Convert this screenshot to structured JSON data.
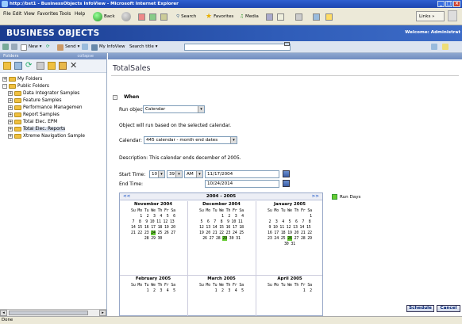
{
  "window": {
    "title": "http://bst1 - BusinessObjects InfoView - Microsoft Internet Explorer"
  },
  "menu": [
    "File",
    "Edit",
    "View",
    "Favorites",
    "Tools",
    "Help"
  ],
  "ietoolbar": {
    "back": "Back",
    "search": "Search",
    "favorites": "Favorites",
    "media": "Media",
    "links": "Links"
  },
  "app": {
    "logo": "BUSINESS OBJECTS",
    "welcome": "Welcome: Administrat"
  },
  "toolbar2": {
    "new": "New",
    "send": "Send",
    "myinfoview": "My InfoView",
    "search_label": "Search title"
  },
  "folders": {
    "title": "Folders",
    "collapse": "collapse",
    "items": [
      {
        "label": "My Folders",
        "level": 0,
        "expander": "+"
      },
      {
        "label": "Public Folders",
        "level": 0,
        "expander": "-"
      },
      {
        "label": "Data Integrator Samples",
        "level": 1,
        "expander": "+"
      },
      {
        "label": "Feature Samples",
        "level": 1,
        "expander": "+"
      },
      {
        "label": "Performance Managemen",
        "level": 1,
        "expander": "+"
      },
      {
        "label": "Report Samples",
        "level": 1,
        "expander": "+"
      },
      {
        "label": "Total Elec. EPM",
        "level": 1,
        "expander": "+"
      },
      {
        "label": "Total Elec. Reports",
        "level": 1,
        "expander": "+",
        "selected": true
      },
      {
        "label": "Xtreme Navigation Sample",
        "level": 1,
        "expander": "+"
      }
    ]
  },
  "main": {
    "title": "TotalSales",
    "when": {
      "label": "When",
      "expander": "-",
      "run_object_label": "Run object:",
      "run_object_value": "Calendar",
      "info": "Object will run based on the selected calendar.",
      "calendar_label": "Calendar:",
      "calendar_value": "445 calendar - month end dates",
      "description": "Description: This calendar ends december of 2005.",
      "start_label": "Start Time:",
      "start_hour": "10",
      "start_min": "39",
      "start_ampm": "AM",
      "start_date": "11/17/2004",
      "end_label": "End Time:",
      "end_date": "10/24/2014"
    },
    "calendar": {
      "range": "2004 - 2005",
      "prev": "<<",
      "next": ">>",
      "months": [
        {
          "name": "November 2004",
          "rows": [
            "Su Mo Tu We Th Fr Sa",
            "    1  2  3  4  5  6",
            "7  8  9 10 11 12 13",
            "14 15 16 17 18 19 20",
            "21 22 23 24 25 26 27",
            "28 29 30"
          ],
          "highlight": "24"
        },
        {
          "name": "December 2004",
          "rows": [
            "Su Mo Tu We Th Fr Sa",
            "          1  2  3  4",
            "5  6  7  8  9 10 11",
            "12 13 14 15 16 17 18",
            "19 20 21 22 23 24 25",
            "26 27 28 29 30 31"
          ],
          "highlight": "29"
        },
        {
          "name": "January 2005",
          "rows": [
            "Su Mo Tu We Th Fr Sa",
            "                   1",
            "2  3  4  5  6  7  8",
            "9 10 11 12 13 14 15",
            "16 17 18 19 20 21 22",
            "23 24 25 26 27 28 29",
            "30 31"
          ],
          "highlight": "26"
        },
        {
          "name": "February 2005",
          "rows": [
            "Su Mo Tu We Th Fr Sa",
            "       1  2  3  4  5"
          ],
          "highlight": ""
        },
        {
          "name": "March 2005",
          "rows": [
            "Su Mo Tu We Th Fr Sa",
            "       1  2  3  4  5"
          ],
          "highlight": ""
        },
        {
          "name": "April 2005",
          "rows": [
            "Su Mo Tu We Th Fr Sa",
            "                1  2"
          ],
          "highlight": ""
        }
      ]
    },
    "legend": "Run Days",
    "schedule_button": "Schedule",
    "cancel_button": "Cancel"
  },
  "status": {
    "text": "Done"
  },
  "colors": {
    "run_day": "#66cc33",
    "logo_bar": "#1b3c8f",
    "title_bar": "#2f5fd0"
  }
}
